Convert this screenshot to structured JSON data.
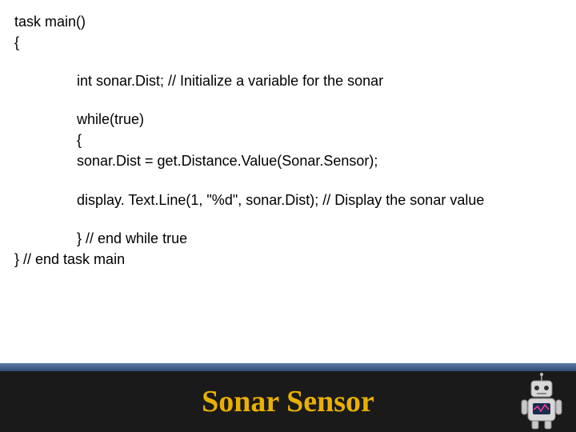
{
  "code": {
    "l1": "task main()",
    "l2": "{",
    "l3": "int sonar.Dist; // Initialize a variable for the sonar",
    "l4": "while(true)",
    "l5": "{",
    "l6": "sonar.Dist = get.Distance.Value(Sonar.Sensor);",
    "l7": "display. Text.Line(1, \"%d\", sonar.Dist); // Display the sonar value",
    "l8": "} // end while true",
    "l9": "} // end task main"
  },
  "footer": {
    "title": "Sonar Sensor"
  }
}
